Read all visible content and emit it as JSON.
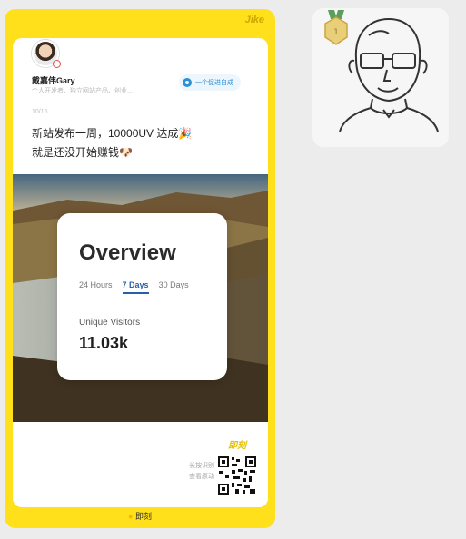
{
  "share_card": {
    "brand_top": "Jike",
    "author": {
      "name": "戴嘉伟Gary",
      "bio": "个人开发者、独立网站产品、创业..."
    },
    "topic_chip": "一个促进自成",
    "time": "10/16",
    "post_lines": [
      "新站发布一周，10000UV 达成🎉",
      "就是还没开始赚钱🐶"
    ],
    "overview": {
      "title": "Overview",
      "tabs": [
        {
          "label": "24 Hours",
          "active": false
        },
        {
          "label": "7 Days",
          "active": true
        },
        {
          "label": "30 Days",
          "active": false
        }
      ],
      "metric_label": "Unique Visitors",
      "metric_value": "11.03k"
    },
    "footer": {
      "brand": "即刻",
      "caption": [
        "长按识别",
        "查看原动"
      ]
    },
    "brand_bottom": "即刻"
  },
  "colors": {
    "frame_yellow": "#ffe01a",
    "tab_active": "#2a5ea8",
    "chip_blue": "#2c8fd8"
  },
  "icons": {
    "topic": "topic-chip-icon",
    "qr": "qr-code-icon",
    "sticker": "bald-man-with-glasses-sticker"
  }
}
